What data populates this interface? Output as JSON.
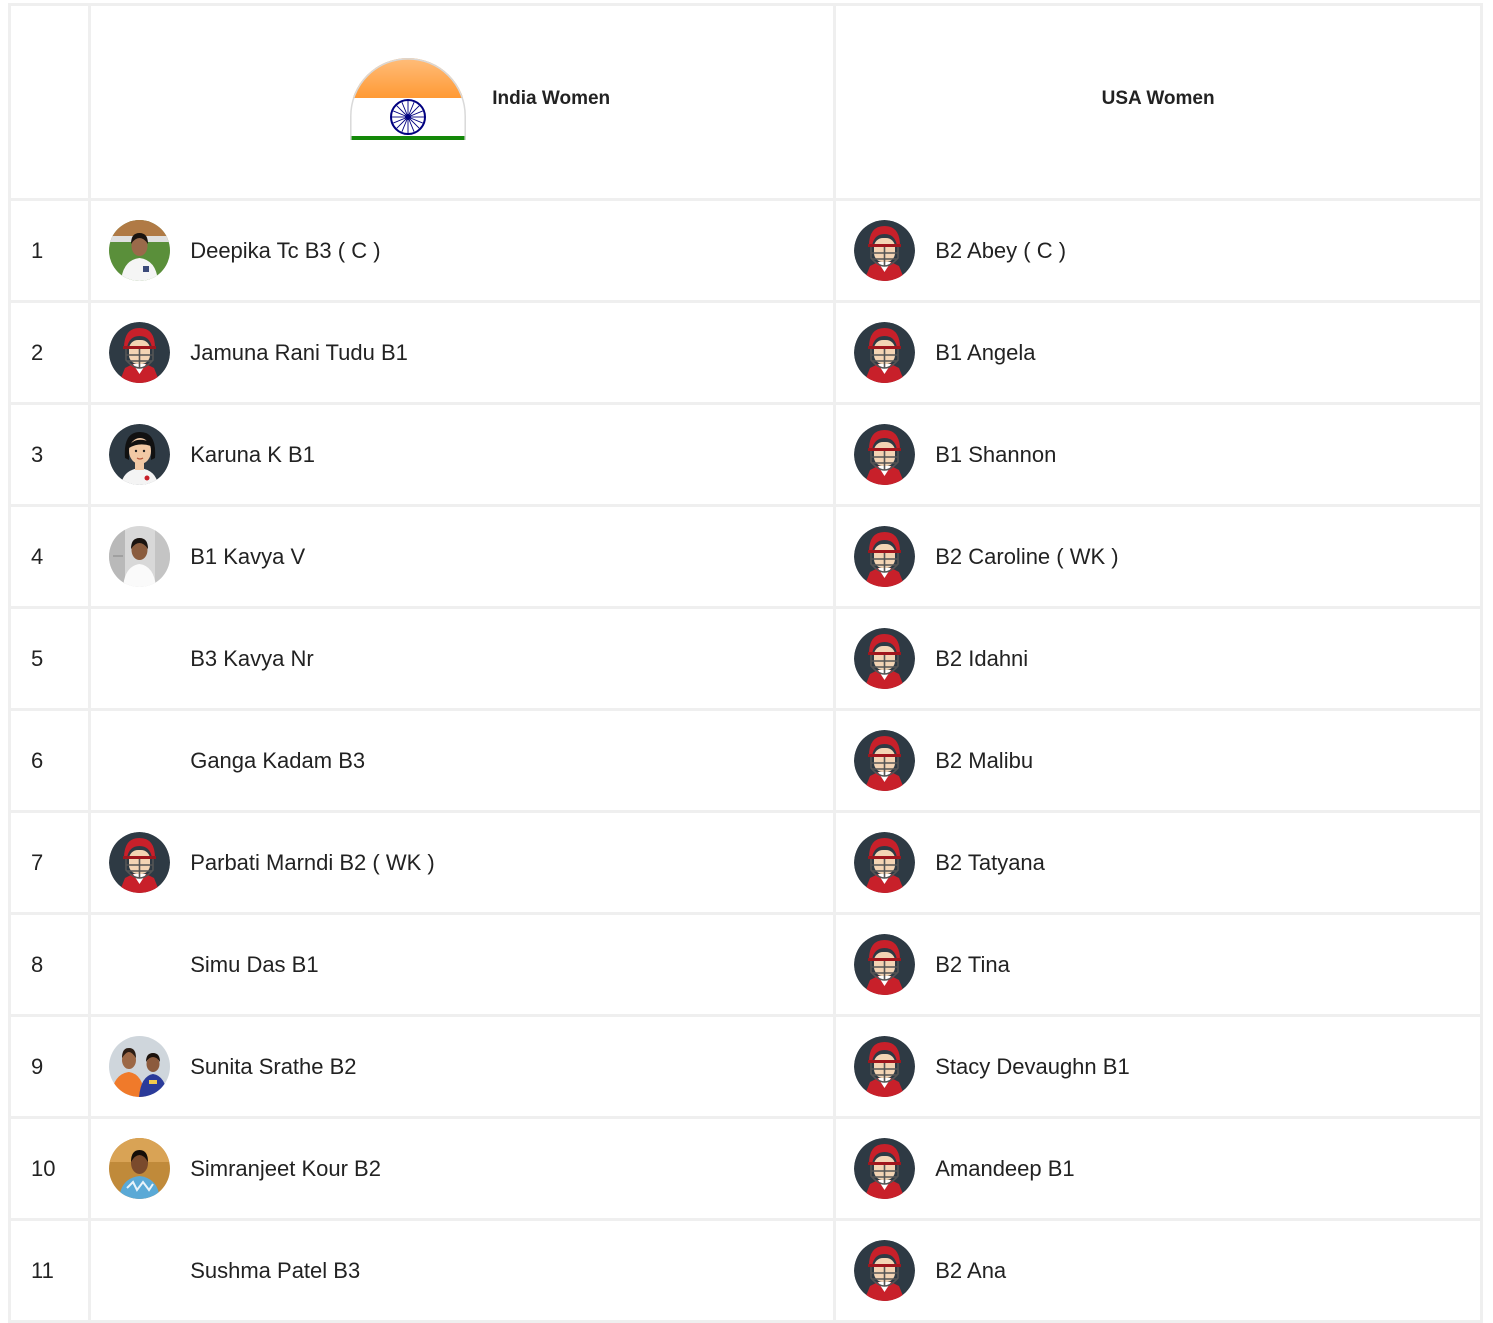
{
  "teams": [
    {
      "name": "India Women",
      "flag_icon": "india-flag-icon"
    },
    {
      "name": "USA Women"
    }
  ],
  "rows": [
    {
      "num": "1",
      "india": {
        "name": "Deepika Tc B3 ( C )",
        "avatar": "photo-field"
      },
      "usa": {
        "name": "B2 Abey ( C )",
        "avatar": "helmet"
      }
    },
    {
      "num": "2",
      "india": {
        "name": "Jamuna Rani Tudu B1",
        "avatar": "helmet"
      },
      "usa": {
        "name": "B1 Angela",
        "avatar": "helmet"
      }
    },
    {
      "num": "3",
      "india": {
        "name": "Karuna K B1",
        "avatar": "cartoon-woman"
      },
      "usa": {
        "name": "B1 Shannon",
        "avatar": "helmet"
      }
    },
    {
      "num": "4",
      "india": {
        "name": "B1 Kavya V",
        "avatar": "photo-indoor"
      },
      "usa": {
        "name": "B2 Caroline ( WK )",
        "avatar": "helmet"
      }
    },
    {
      "num": "5",
      "india": {
        "name": "B3 Kavya Nr",
        "avatar": "none"
      },
      "usa": {
        "name": "B2 Idahni",
        "avatar": "helmet"
      }
    },
    {
      "num": "6",
      "india": {
        "name": "Ganga Kadam B3",
        "avatar": "none"
      },
      "usa": {
        "name": "B2 Malibu",
        "avatar": "helmet"
      }
    },
    {
      "num": "7",
      "india": {
        "name": "Parbati Marndi B2 ( WK )",
        "avatar": "helmet"
      },
      "usa": {
        "name": "B2 Tatyana",
        "avatar": "helmet"
      }
    },
    {
      "num": "8",
      "india": {
        "name": "Simu Das B1",
        "avatar": "none"
      },
      "usa": {
        "name": "B2 Tina",
        "avatar": "helmet"
      }
    },
    {
      "num": "9",
      "india": {
        "name": "Sunita Srathe B2",
        "avatar": "photo-duo"
      },
      "usa": {
        "name": "Stacy Devaughn B1",
        "avatar": "helmet"
      }
    },
    {
      "num": "10",
      "india": {
        "name": "Simranjeet Kour B2",
        "avatar": "photo-blue"
      },
      "usa": {
        "name": "Amandeep B1",
        "avatar": "helmet"
      }
    },
    {
      "num": "11",
      "india": {
        "name": "Sushma Patel B3",
        "avatar": "none"
      },
      "usa": {
        "name": "B2 Ana",
        "avatar": "helmet"
      }
    }
  ],
  "colors": {
    "saffron": "#FF9933",
    "green": "#138808",
    "chakra": "#000080",
    "helmet_red": "#c8202a",
    "avatar_bg": "#2e3a44",
    "grid": "#efefef"
  }
}
